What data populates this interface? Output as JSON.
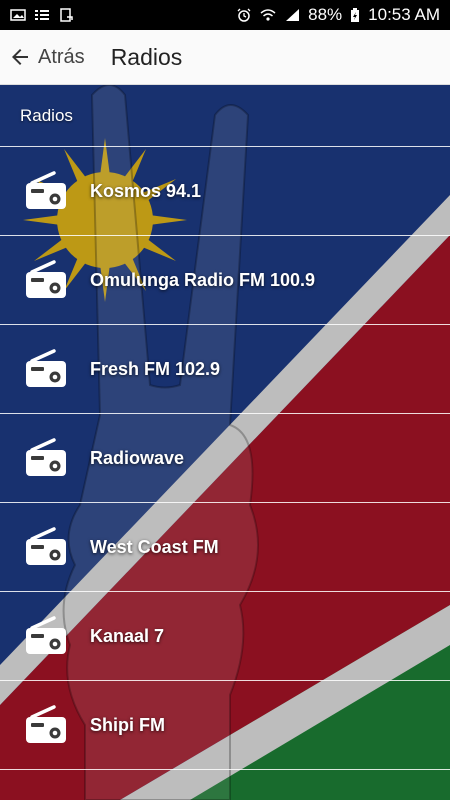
{
  "status_bar": {
    "left_icons": [
      "image-icon",
      "list-icon",
      "sync-icon"
    ],
    "right_icons": [
      "alarm-icon",
      "wifi-icon",
      "signal-icon",
      "battery-icon"
    ],
    "battery": "88%",
    "time": "10:53 AM"
  },
  "app_bar": {
    "back_label": "Atrás",
    "title": "Radios"
  },
  "section": {
    "title": "Radios"
  },
  "stations": [
    {
      "name": "Kosmos 94.1",
      "icon": "radio-icon"
    },
    {
      "name": "Omulunga Radio FM 100.9",
      "icon": "radio-icon"
    },
    {
      "name": "Fresh FM 102.9",
      "icon": "radio-icon"
    },
    {
      "name": "Radiowave",
      "icon": "radio-icon"
    },
    {
      "name": "West Coast FM",
      "icon": "radio-icon"
    },
    {
      "name": "Kanaal 7",
      "icon": "radio-icon"
    },
    {
      "name": "Shipi FM",
      "icon": "radio-icon"
    }
  ],
  "colors": {
    "flag_blue": "#1f3f8f",
    "flag_red": "#b3152a",
    "flag_green": "#1f8a3a",
    "flag_white": "#f2f2f2",
    "sun_yellow": "#f2c41c"
  }
}
